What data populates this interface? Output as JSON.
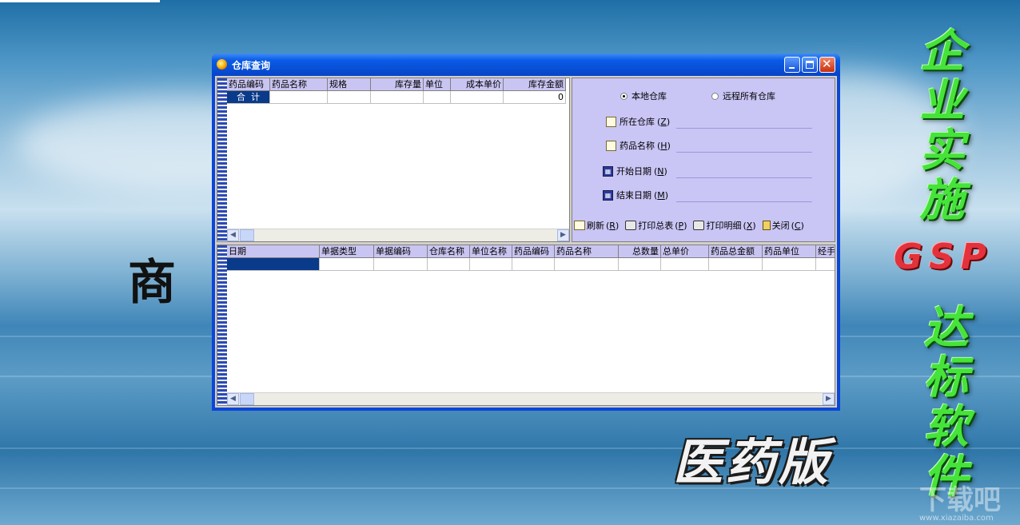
{
  "desktop": {
    "vertical_slogan_1": "企业实施",
    "gsp_text": "GSP",
    "vertical_slogan_2": "达标软件",
    "edition_text": "医药版",
    "partial_char": "商",
    "watermark": "下载吧",
    "watermark_url": "www.xiazaiba.com"
  },
  "window": {
    "title": "仓库查询",
    "minimize_icon": "minimize-icon",
    "maximize_icon": "maximize-icon",
    "close_icon": "close-icon"
  },
  "top_grid": {
    "columns": [
      "药品编码",
      "药品名称",
      "规格",
      "库存量",
      "单位",
      "成本单价",
      "库存金额"
    ],
    "total_row": {
      "label": "合  计",
      "amount": "0"
    }
  },
  "bottom_grid": {
    "columns": [
      "日期",
      "单据类型",
      "单据编码",
      "仓库名称",
      "单位名称",
      "药品编码",
      "药品名称",
      "总数量",
      "总单价",
      "药品总金额",
      "药品单位",
      "经手"
    ]
  },
  "panel": {
    "radio_local": "本地仓库",
    "radio_remote": "远程所有仓库",
    "selected": "local",
    "fields": [
      {
        "label": "所在仓库",
        "key": "Z"
      },
      {
        "label": "药品名称",
        "key": "H"
      },
      {
        "label": "开始日期",
        "key": "N"
      },
      {
        "label": "结束日期",
        "key": "M"
      }
    ],
    "actions": [
      {
        "label": "刷新",
        "key": "R"
      },
      {
        "label": "打印总表",
        "key": "P"
      },
      {
        "label": "打印明细",
        "key": "X"
      },
      {
        "label": "关闭",
        "key": "C"
      }
    ]
  },
  "colors": {
    "titlebar": "#0a46d8",
    "header_bg": "#c9c5f2",
    "selected_cell": "#0a3a8a",
    "slogan_green": "#46e33a",
    "gsp_red": "#e3323c"
  }
}
